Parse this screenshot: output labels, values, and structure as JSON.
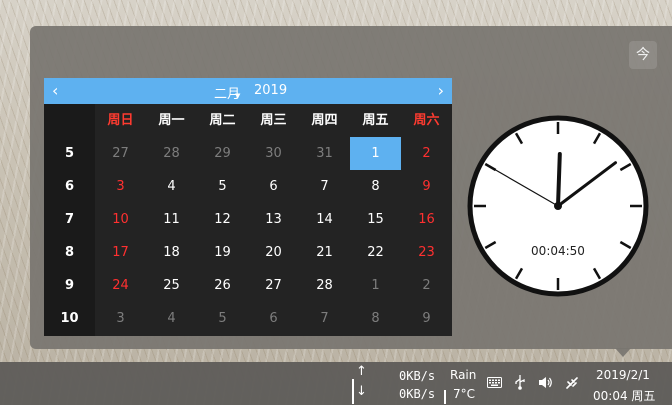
{
  "calendar": {
    "month": "二月",
    "year": "2019",
    "weekday_headers": [
      {
        "label": "周日",
        "weekend": true
      },
      {
        "label": "周一",
        "weekend": false
      },
      {
        "label": "周二",
        "weekend": false
      },
      {
        "label": "周三",
        "weekend": false
      },
      {
        "label": "周四",
        "weekend": false
      },
      {
        "label": "周五",
        "weekend": false
      },
      {
        "label": "周六",
        "weekend": true
      }
    ],
    "week_numbers": [
      "5",
      "6",
      "7",
      "8",
      "9",
      "10"
    ],
    "rows": [
      [
        {
          "d": "27",
          "m": "prev"
        },
        {
          "d": "28",
          "m": "prev"
        },
        {
          "d": "29",
          "m": "prev"
        },
        {
          "d": "30",
          "m": "prev"
        },
        {
          "d": "31",
          "m": "prev"
        },
        {
          "d": "1",
          "m": "cur",
          "selected": true
        },
        {
          "d": "2",
          "m": "cur"
        }
      ],
      [
        {
          "d": "3",
          "m": "cur"
        },
        {
          "d": "4",
          "m": "cur"
        },
        {
          "d": "5",
          "m": "cur"
        },
        {
          "d": "6",
          "m": "cur"
        },
        {
          "d": "7",
          "m": "cur"
        },
        {
          "d": "8",
          "m": "cur"
        },
        {
          "d": "9",
          "m": "cur"
        }
      ],
      [
        {
          "d": "10",
          "m": "cur"
        },
        {
          "d": "11",
          "m": "cur"
        },
        {
          "d": "12",
          "m": "cur"
        },
        {
          "d": "13",
          "m": "cur"
        },
        {
          "d": "14",
          "m": "cur"
        },
        {
          "d": "15",
          "m": "cur"
        },
        {
          "d": "16",
          "m": "cur"
        }
      ],
      [
        {
          "d": "17",
          "m": "cur"
        },
        {
          "d": "18",
          "m": "cur"
        },
        {
          "d": "19",
          "m": "cur"
        },
        {
          "d": "20",
          "m": "cur"
        },
        {
          "d": "21",
          "m": "cur"
        },
        {
          "d": "22",
          "m": "cur"
        },
        {
          "d": "23",
          "m": "cur"
        }
      ],
      [
        {
          "d": "24",
          "m": "cur"
        },
        {
          "d": "25",
          "m": "cur"
        },
        {
          "d": "26",
          "m": "cur"
        },
        {
          "d": "27",
          "m": "cur"
        },
        {
          "d": "28",
          "m": "cur"
        },
        {
          "d": "1",
          "m": "next"
        },
        {
          "d": "2",
          "m": "next"
        }
      ],
      [
        {
          "d": "3",
          "m": "next"
        },
        {
          "d": "4",
          "m": "next"
        },
        {
          "d": "5",
          "m": "next"
        },
        {
          "d": "6",
          "m": "next"
        },
        {
          "d": "7",
          "m": "next"
        },
        {
          "d": "8",
          "m": "next"
        },
        {
          "d": "9",
          "m": "next"
        }
      ]
    ]
  },
  "today_button": "今",
  "clock": {
    "digital": "00:04:50",
    "hour": 0,
    "minute": 4,
    "second": 50
  },
  "taskbar": {
    "upload_speed": "0KB/s",
    "download_speed": "0KB/s",
    "weather_condition": "Rain",
    "weather_temp": "7°C",
    "date": "2019/2/1",
    "time_weekday": "00:04 周五"
  },
  "icons": [
    "chevron-left-icon",
    "chevron-right-icon",
    "chevron-down-icon",
    "arrow-up-icon",
    "arrow-down-icon",
    "keyboard-icon",
    "usb-icon",
    "volume-icon",
    "network-icon"
  ],
  "colors": {
    "accent": "#5eb1f0",
    "weekend": "#ff3030",
    "other_month": "#7d7d7d"
  }
}
